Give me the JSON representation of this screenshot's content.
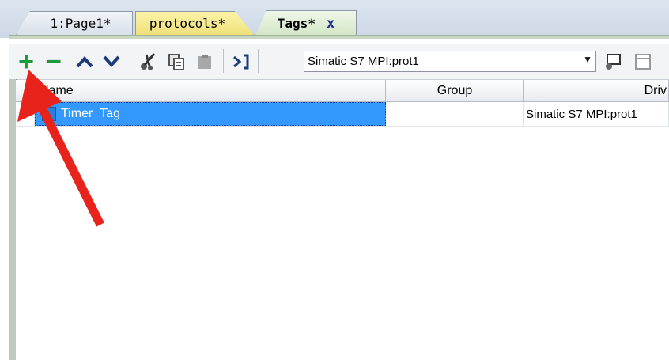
{
  "tabs": [
    {
      "label": "1:Page1*"
    },
    {
      "label": "protocols*"
    },
    {
      "label": "Tags*",
      "close": "x"
    }
  ],
  "toolbar": {
    "add": "+",
    "remove": "−",
    "protocol_select": "Simatic S7 MPI:prot1"
  },
  "table": {
    "headers": [
      "Name",
      "Group",
      "Driv"
    ],
    "rows": [
      {
        "name": "Timer_Tag",
        "group": "",
        "driver": "Simatic S7 MPI:prot1"
      }
    ]
  },
  "colors": {
    "selection": "#3399ff",
    "arrow": "#e8231c",
    "add_icon": "#1b9a3c"
  }
}
